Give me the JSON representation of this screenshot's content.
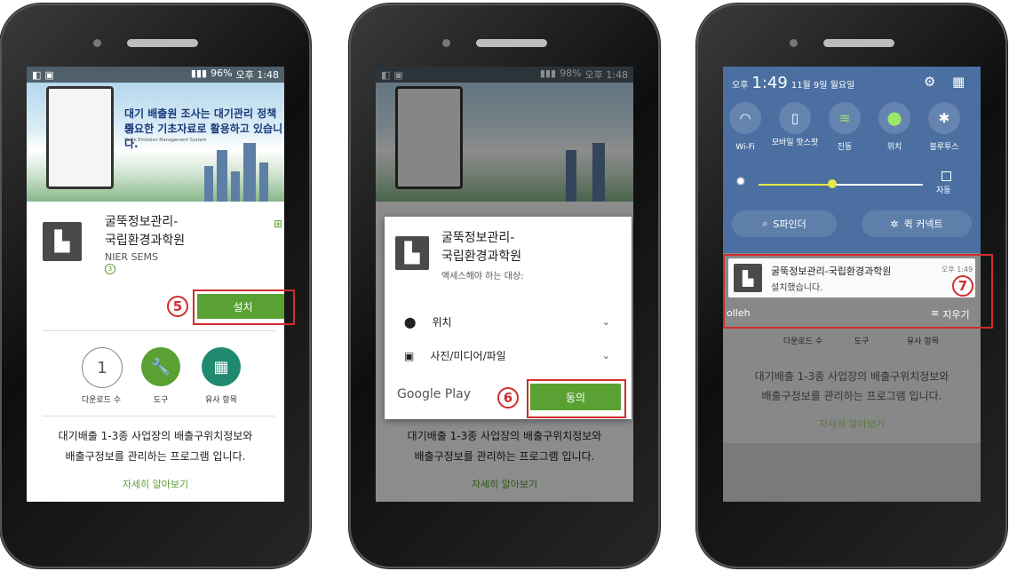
{
  "phone1": {
    "status_time": "오후 1:48",
    "status_battery": "96%",
    "banner_line1": "대기 배출원 조사는 대기관리 정책의",
    "banner_line2": "중요한 기초자료로 활용하고 있습니다.",
    "banner_sub": "Stack Emission Management System",
    "app_title_line1": "굴뚝정보관리-",
    "app_title_line2": "국립환경과학원",
    "developer": "NIER SEMS",
    "rating_badge": "3",
    "install_label": "설치",
    "step_number": "5",
    "downloads_value": "1",
    "downloads_label": "다운로드 수",
    "tools_label": "도구",
    "similar_label": "유사 항목",
    "description_line1": "대기배출 1-3종 사업장의 배출구위치정보와",
    "description_line2": "배출구정보를 관리하는 프로그램 입니다.",
    "more_link": "자세히 알아보기"
  },
  "phone2": {
    "status_time": "오후 1:48",
    "status_battery": "98%",
    "dialog_title_line1": "굴뚝정보관리-",
    "dialog_title_line2": "국립환경과학원",
    "dialog_subtitle": "액세스해야 하는 대상:",
    "permissions": [
      {
        "label": "위치",
        "icon": "location-pin-icon"
      },
      {
        "label": "사진/미디어/파일",
        "icon": "photo-icon"
      }
    ],
    "store_brand": "Google Play",
    "agree_label": "동의",
    "step_number": "6",
    "description_line1": "대기배출 1-3종 사업장의 배출구위치정보와",
    "description_line2": "배출구정보를 관리하는 프로그램 입니다.",
    "more_link": "자세히 알아보기"
  },
  "phone3": {
    "time_prefix": "오후",
    "time": "1:49",
    "date": "11월 9일 월요일",
    "quick_settings": [
      {
        "label": "Wi-Fi",
        "icon": "wifi-icon"
      },
      {
        "label": "모바일 핫스팟",
        "icon": "hotspot-icon"
      },
      {
        "label": "진동",
        "icon": "vibrate-icon"
      },
      {
        "label": "위치",
        "icon": "location-icon"
      },
      {
        "label": "블루투스",
        "icon": "bluetooth-icon"
      }
    ],
    "auto_label": "자동",
    "brightness_level": 0.45,
    "s_finder": "S파인더",
    "quick_connect": "퀵 커넥트",
    "notif_title": "굴뚝정보관리-국립환경과학원",
    "notif_time": "오후 1:49",
    "notif_body": "설치했습니다.",
    "carrier": "olleh",
    "clear_label": "지우기",
    "step_number": "7",
    "downloads_label": "다운로드 수",
    "tools_label": "도구",
    "similar_label": "유사 항목",
    "description_line1": "대기배출 1-3종 사업장의 배출구위치정보와",
    "description_line2": "배출구정보를 관리하는 프로그램 입니다.",
    "more_link": "자세히 알아보기"
  },
  "colors": {
    "accent_green": "#5aa133",
    "step_red": "#d12d2d",
    "qs_blue": "#4a6fa0"
  }
}
